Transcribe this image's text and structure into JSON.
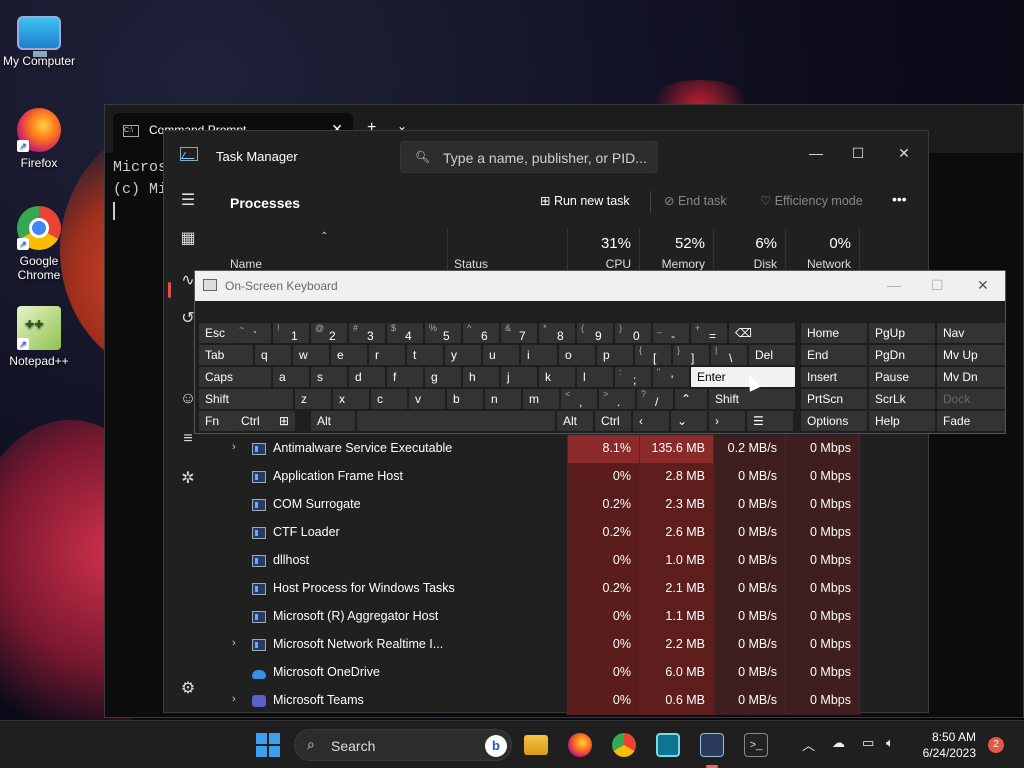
{
  "desktop": {
    "icons": [
      {
        "label": "My Computer",
        "icon": "computer-icon"
      },
      {
        "label": "Firefox",
        "icon": "firefox-icon"
      },
      {
        "label": "Google Chrome",
        "icon": "chrome-icon"
      },
      {
        "label": "Notepad++",
        "icon": "notepadpp-icon"
      }
    ]
  },
  "cmd": {
    "tab_title": "Command Prompt",
    "close": "✕",
    "new_tab": "+",
    "dropdown": "⌄",
    "line1": "Micros",
    "line2": "(c) Mi"
  },
  "task_manager": {
    "title": "Task Manager",
    "search_placeholder": "Type a name, publisher, or PID...",
    "minimize": "—",
    "maximize": "☐",
    "close": "✕",
    "page_title": "Processes",
    "toolbar": {
      "run_new_task": "Run new task",
      "end_task": "End task",
      "efficiency_mode": "Efficiency mode",
      "more": "•••"
    },
    "columns": {
      "name": "Name",
      "status": "Status",
      "cpu_pct": "31%",
      "cpu": "CPU",
      "memory_pct": "52%",
      "memory": "Memory",
      "disk_pct": "6%",
      "disk": "Disk",
      "network_pct": "0%",
      "network": "Network"
    },
    "processes": [
      {
        "name": "Antimalware Service Executable",
        "expandable": true,
        "cpu": "8.1%",
        "memory": "135.6 MB",
        "disk": "0.2 MB/s",
        "network": "0 Mbps",
        "hot": true,
        "icon": "app"
      },
      {
        "name": "Application Frame Host",
        "expandable": false,
        "cpu": "0%",
        "memory": "2.8 MB",
        "disk": "0 MB/s",
        "network": "0 Mbps",
        "icon": "app"
      },
      {
        "name": "COM Surrogate",
        "expandable": false,
        "cpu": "0.2%",
        "memory": "2.3 MB",
        "disk": "0 MB/s",
        "network": "0 Mbps",
        "icon": "app"
      },
      {
        "name": "CTF Loader",
        "expandable": false,
        "cpu": "0.2%",
        "memory": "2.6 MB",
        "disk": "0 MB/s",
        "network": "0 Mbps",
        "icon": "app"
      },
      {
        "name": "dllhost",
        "expandable": false,
        "cpu": "0%",
        "memory": "1.0 MB",
        "disk": "0 MB/s",
        "network": "0 Mbps",
        "icon": "app"
      },
      {
        "name": "Host Process for Windows Tasks",
        "expandable": false,
        "cpu": "0.2%",
        "memory": "2.1 MB",
        "disk": "0 MB/s",
        "network": "0 Mbps",
        "icon": "app"
      },
      {
        "name": "Microsoft (R) Aggregator Host",
        "expandable": false,
        "cpu": "0%",
        "memory": "1.1 MB",
        "disk": "0 MB/s",
        "network": "0 Mbps",
        "icon": "app"
      },
      {
        "name": "Microsoft Network Realtime I...",
        "expandable": true,
        "cpu": "0%",
        "memory": "2.2 MB",
        "disk": "0 MB/s",
        "network": "0 Mbps",
        "icon": "app"
      },
      {
        "name": "Microsoft OneDrive",
        "expandable": false,
        "cpu": "0%",
        "memory": "6.0 MB",
        "disk": "0 MB/s",
        "network": "0 Mbps",
        "icon": "cloud"
      },
      {
        "name": "Microsoft Teams",
        "expandable": true,
        "cpu": "0%",
        "memory": "0.6 MB",
        "disk": "0 MB/s",
        "network": "0 Mbps",
        "icon": "teams"
      }
    ]
  },
  "osk": {
    "title": "On-Screen Keyboard",
    "minimize": "—",
    "maximize": "☐",
    "close": "✕",
    "rows": [
      [
        {
          "l": "Esc"
        },
        {
          "s": "~",
          "m": "`"
        },
        {
          "s": "!",
          "m": "1"
        },
        {
          "s": "@",
          "m": "2"
        },
        {
          "s": "#",
          "m": "3"
        },
        {
          "s": "$",
          "m": "4"
        },
        {
          "s": "%",
          "m": "5"
        },
        {
          "s": "^",
          "m": "6"
        },
        {
          "s": "&",
          "m": "7"
        },
        {
          "s": "*",
          "m": "8"
        },
        {
          "s": "(",
          "m": "9"
        },
        {
          "s": ")",
          "m": "0"
        },
        {
          "s": "_",
          "m": "-"
        },
        {
          "s": "+",
          "m": "="
        },
        {
          "l": "⌫"
        },
        {
          "l": "Home"
        },
        {
          "l": "PgUp"
        },
        {
          "l": "Nav"
        }
      ],
      [
        {
          "l": "Tab"
        },
        {
          "l": "q"
        },
        {
          "l": "w"
        },
        {
          "l": "e"
        },
        {
          "l": "r"
        },
        {
          "l": "t"
        },
        {
          "l": "y"
        },
        {
          "l": "u"
        },
        {
          "l": "i"
        },
        {
          "l": "o"
        },
        {
          "l": "p"
        },
        {
          "s": "{",
          "m": "["
        },
        {
          "s": "}",
          "m": "]"
        },
        {
          "s": "|",
          "m": "\\"
        },
        {
          "l": "Del"
        },
        {
          "l": "End"
        },
        {
          "l": "PgDn"
        },
        {
          "l": "Mv Up"
        }
      ],
      [
        {
          "l": "Caps"
        },
        {
          "l": "a"
        },
        {
          "l": "s"
        },
        {
          "l": "d"
        },
        {
          "l": "f"
        },
        {
          "l": "g"
        },
        {
          "l": "h"
        },
        {
          "l": "j"
        },
        {
          "l": "k"
        },
        {
          "l": "l"
        },
        {
          "s": ":",
          "m": ";"
        },
        {
          "s": "\"",
          "m": "'"
        },
        {
          "l": "Enter"
        },
        {
          "l": "Insert"
        },
        {
          "l": "Pause"
        },
        {
          "l": "Mv Dn"
        }
      ],
      [
        {
          "l": "Shift"
        },
        {
          "l": "z"
        },
        {
          "l": "x"
        },
        {
          "l": "c"
        },
        {
          "l": "v"
        },
        {
          "l": "b"
        },
        {
          "l": "n"
        },
        {
          "l": "m"
        },
        {
          "s": "<",
          "m": ","
        },
        {
          "s": ">",
          "m": "."
        },
        {
          "s": "?",
          "m": "/"
        },
        {
          "l": "⌃"
        },
        {
          "l": "Shift"
        },
        {
          "l": "PrtScn"
        },
        {
          "l": "ScrLk"
        },
        {
          "l": "Dock"
        }
      ],
      [
        {
          "l": "Fn"
        },
        {
          "l": "Ctrl"
        },
        {
          "l": "⊞"
        },
        {
          "l": "Alt"
        },
        {
          "l": ""
        },
        {
          "l": "Alt"
        },
        {
          "l": "Ctrl"
        },
        {
          "l": "‹"
        },
        {
          "l": "⌄"
        },
        {
          "l": "›"
        },
        {
          "l": "☰"
        },
        {
          "l": "Options"
        },
        {
          "l": "Help"
        },
        {
          "l": "Fade"
        }
      ]
    ]
  },
  "taskbar": {
    "search_label": "Search",
    "clock_time": "8:50 AM",
    "clock_date": "6/24/2023",
    "notification_count": "2"
  },
  "colors": {
    "heat_cpu": "#5a1c1c",
    "heat_hot": "#8a2a2a",
    "accent": "#3aa0f0"
  }
}
